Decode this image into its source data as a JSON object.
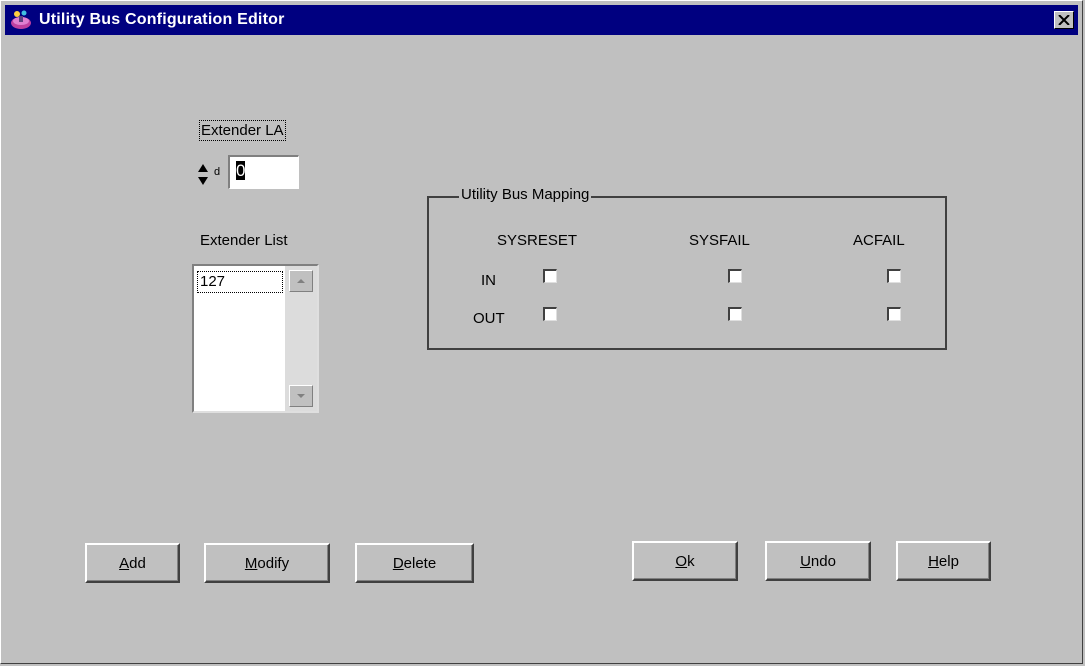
{
  "window": {
    "title": "Utility Bus Configuration Editor",
    "close_glyph": "×"
  },
  "extender_la": {
    "label": "Extender LA",
    "radix": "d",
    "value": "0"
  },
  "extender_list": {
    "label": "Extender List",
    "items": [
      "127"
    ]
  },
  "mapping": {
    "title": "Utility Bus Mapping",
    "columns": [
      "SYSRESET",
      "SYSFAIL",
      "ACFAIL"
    ],
    "rows": [
      "IN",
      "OUT"
    ],
    "checked": [
      [
        false,
        false,
        false
      ],
      [
        false,
        false,
        false
      ]
    ]
  },
  "buttons": {
    "add": {
      "accel": "A",
      "rest": "dd"
    },
    "modify": {
      "accel": "M",
      "rest": "odify"
    },
    "delete": {
      "accel": "D",
      "rest": "elete"
    },
    "ok": {
      "accel": "O",
      "rest": "k"
    },
    "undo": {
      "accel": "U",
      "rest": "ndo"
    },
    "help": {
      "accel": "H",
      "rest": "elp"
    }
  },
  "icons": {
    "app": "app-icon",
    "close": "close-icon",
    "spin": "spin-arrows-icon",
    "scroll_up": "scroll-up-icon",
    "scroll_down": "scroll-down-icon"
  }
}
